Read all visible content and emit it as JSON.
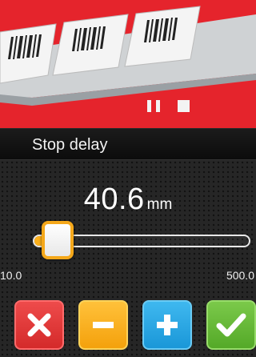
{
  "header": {
    "title": "Stop delay"
  },
  "value": {
    "number": "40.6",
    "unit": "mm"
  },
  "slider": {
    "min_label": "10.0",
    "max_label": "500.0",
    "min": 10.0,
    "max": 500.0,
    "current": 40.6
  },
  "buttons": {
    "cancel_icon": "close-icon",
    "decrement_icon": "minus-icon",
    "increment_icon": "plus-icon",
    "confirm_icon": "checkmark-icon"
  },
  "colors": {
    "hero_background": "#e5242c",
    "cancel": "#e03636",
    "decrement": "#f7ab16",
    "increment": "#2aa8e4",
    "confirm": "#64b834",
    "slider_accent": "#f5a81a"
  }
}
